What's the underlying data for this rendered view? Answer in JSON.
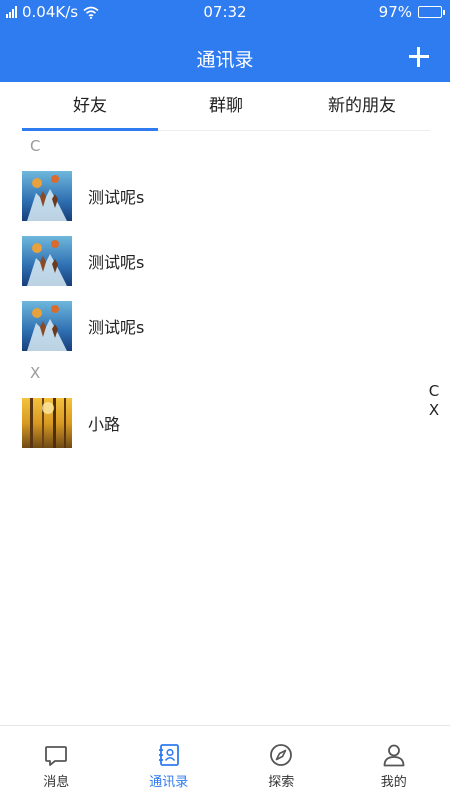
{
  "status_bar": {
    "network": "0.04K/s",
    "time": "07:32",
    "battery": "97%",
    "battery_level": 0.97
  },
  "header": {
    "title": "通讯录",
    "add_icon": "plus-icon"
  },
  "tabs": [
    {
      "label": "好友",
      "active": true
    },
    {
      "label": "群聊",
      "active": false
    },
    {
      "label": "新的朋友",
      "active": false
    }
  ],
  "sections": [
    {
      "letter": "C",
      "contacts": [
        {
          "name": "测试呢s",
          "avatar": "underwater-photo"
        },
        {
          "name": "测试呢s",
          "avatar": "underwater-photo"
        },
        {
          "name": "测试呢s",
          "avatar": "underwater-photo"
        }
      ]
    },
    {
      "letter": "X",
      "contacts": [
        {
          "name": "小路",
          "avatar": "autumn-forest-photo"
        }
      ]
    }
  ],
  "index_bar": [
    "C",
    "X"
  ],
  "bottom_nav": [
    {
      "label": "消息",
      "icon": "chat-bubble-icon",
      "active": false
    },
    {
      "label": "通讯录",
      "icon": "contacts-book-icon",
      "active": true
    },
    {
      "label": "探索",
      "icon": "compass-icon",
      "active": false
    },
    {
      "label": "我的",
      "icon": "person-icon",
      "active": false
    }
  ],
  "colors": {
    "accent": "#2f7bf0",
    "text": "#222222",
    "muted": "#9a9a9a"
  }
}
